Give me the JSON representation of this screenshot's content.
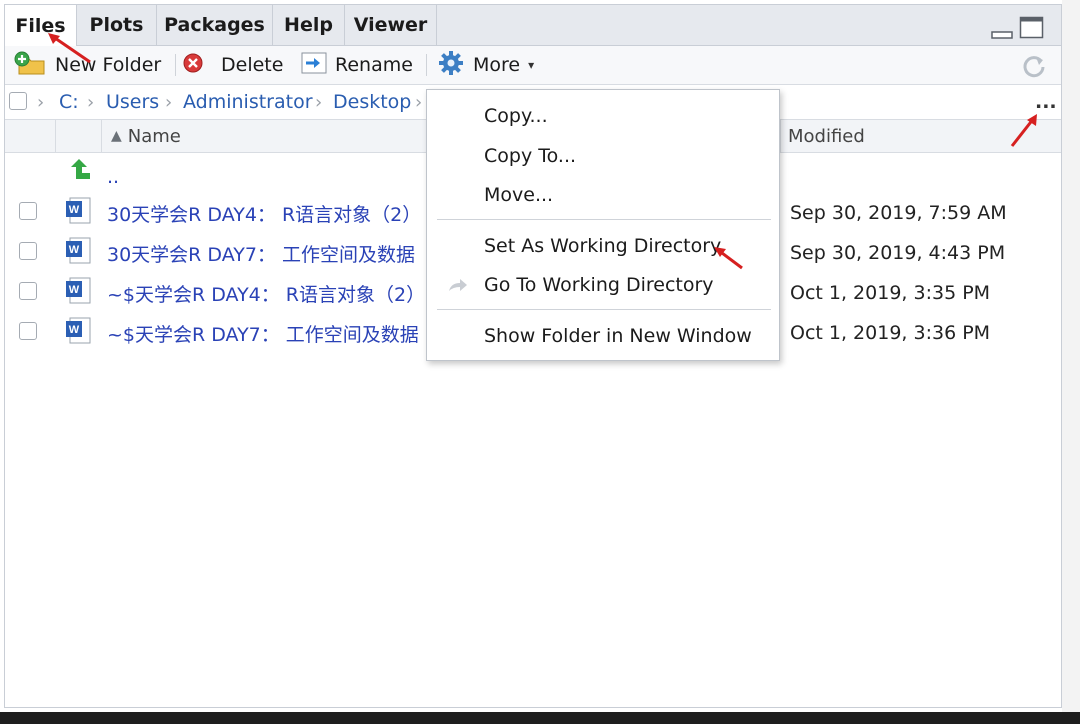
{
  "tabs": [
    {
      "label": "Files",
      "active": true
    },
    {
      "label": "Plots"
    },
    {
      "label": "Packages"
    },
    {
      "label": "Help"
    },
    {
      "label": "Viewer"
    }
  ],
  "toolbar": {
    "new_folder": "New Folder",
    "delete": "Delete",
    "rename": "Rename",
    "more": "More"
  },
  "breadcrumb": [
    "C:",
    "Users",
    "Administrator",
    "Desktop"
  ],
  "breadcrumb_overflow": "...",
  "columns": {
    "name": "Name",
    "modified": "Modified"
  },
  "parent_dir": "..",
  "files": [
    {
      "name": "30天学会R DAY4： R语言对象（2）",
      "modified": "Sep 30, 2019, 7:59 AM"
    },
    {
      "name": "30天学会R DAY7： 工作空间及数据",
      "modified": "Sep 30, 2019, 4:43 PM"
    },
    {
      "name": "~$天学会R DAY4： R语言对象（2）",
      "modified": "Oct 1, 2019, 3:35 PM"
    },
    {
      "name": "~$天学会R DAY7： 工作空间及数据",
      "modified": "Oct 1, 2019, 3:36 PM"
    }
  ],
  "more_menu": {
    "copy": "Copy...",
    "copy_to": "Copy To...",
    "move": "Move...",
    "set_wd": "Set As Working Directory",
    "go_wd": "Go To Working Directory",
    "show_folder": "Show Folder in New Window"
  },
  "colors": {
    "link": "#2a42b6",
    "breadcrumb": "#2a5db0",
    "annotation": "#d62020"
  }
}
